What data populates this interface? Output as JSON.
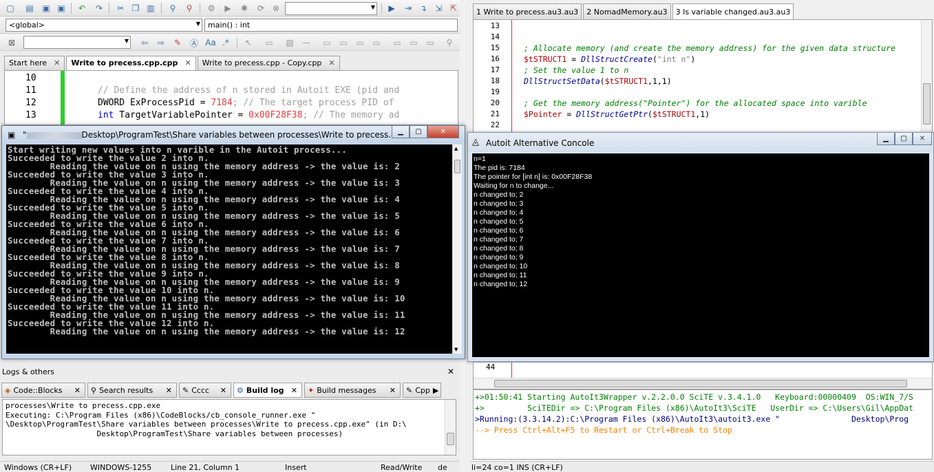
{
  "codeblocks": {
    "scope_combo": "<global>",
    "function_combo": "main() : int",
    "tabs": [
      {
        "label": "Start here",
        "active": false
      },
      {
        "label": "Write to precess.cpp.cpp",
        "active": true
      },
      {
        "label": "Write to precess.cpp - Copy.cpp",
        "active": false
      }
    ],
    "editor_lines": [
      {
        "num": "10",
        "text": ""
      },
      {
        "num": "11",
        "text": "// Define the address of n stored in Autoit EXE (pid and"
      },
      {
        "num": "12",
        "text_kw": "DWORD ExProcessPid = ",
        "text_num": "7184",
        "text_cmt": "; // The target process PID of"
      },
      {
        "num": "13",
        "text_kw": "int",
        "text_mid": " TargetVariablePointer = ",
        "text_num": "0x00F28F38",
        "text_cmt": "; // The memory ad"
      }
    ],
    "logs": {
      "header": "Logs & others",
      "tabs": [
        {
          "label": "Code::Blocks",
          "active": false
        },
        {
          "label": "Search results",
          "active": false
        },
        {
          "label": "Cccc",
          "active": false
        },
        {
          "label": "Build log",
          "active": true
        },
        {
          "label": "Build messages",
          "active": false
        },
        {
          "label": "Cpp",
          "active": false
        }
      ],
      "text": "processes\\Write to precess.cpp.exe\nExecuting: C:\\Program Files (x86)\\CodeBlocks/cb_console_runner.exe \"\n\\Desktop\\ProgramTest\\Share variables between processes\\Write to precess.cpp.exe\" (in D:\\\n                    Desktop\\ProgramTest\\Share variables between processes)"
    },
    "status": {
      "eol": "Windows (CR+LF)",
      "encoding": "WINDOWS-1255",
      "position": "Line 21, Column 1",
      "mode": "Insert",
      "access": "Read/Write",
      "extra": "de"
    }
  },
  "console": {
    "title_prefix": "\"",
    "title": "Desktop\\ProgramTest\\Share variables between processes\\Write to precess.c...",
    "output": "Start writing new values into n varible in the Autoit process...\nSucceeded to write the value 2 into n.\n        Reading the value on n using the memory address -> the value is: 2\nSucceeded to write the value 3 into n.\n        Reading the value on n using the memory address -> the value is: 3\nSucceeded to write the value 4 into n.\n        Reading the value on n using the memory address -> the value is: 4\nSucceeded to write the value 5 into n.\n        Reading the value on n using the memory address -> the value is: 5\nSucceeded to write the value 6 into n.\n        Reading the value on n using the memory address -> the value is: 6\nSucceeded to write the value 7 into n.\n        Reading the value on n using the memory address -> the value is: 7\nSucceeded to write the value 8 into n.\n        Reading the value on n using the memory address -> the value is: 8\nSucceeded to write the value 9 into n.\n        Reading the value on n using the memory address -> the value is: 9\nSucceeded to write the value 10 into n.\n        Reading the value on n using the memory address -> the value is: 10\nSucceeded to write the value 11 into n.\n        Reading the value on n using the memory address -> the value is: 11\nSucceeded to write the value 12 into n.\n        Reading the value on n using the memory address -> the value is: 12"
  },
  "scite": {
    "tabs": [
      {
        "label": "1 Write to precess.au3.au3",
        "active": false
      },
      {
        "label": "2 NomadMemory.au3",
        "active": false
      },
      {
        "label": "3 Is variable changed.au3.au3",
        "active": true
      }
    ],
    "lines": [
      {
        "num": "13",
        "parts": []
      },
      {
        "num": "14",
        "parts": []
      },
      {
        "num": "15",
        "parts": [
          {
            "c": "scmt",
            "t": "; Allocate memory (and create the memory address) for the given data structure"
          }
        ]
      },
      {
        "num": "16",
        "parts": [
          {
            "c": "svar",
            "t": "$tSTRUCT1"
          },
          {
            "c": "",
            "t": " = "
          },
          {
            "c": "sfn",
            "t": "DllStructCreate"
          },
          {
            "c": "",
            "t": "("
          },
          {
            "c": "sstr",
            "t": "\"int n\""
          },
          {
            "c": "",
            "t": ")"
          }
        ]
      },
      {
        "num": "17",
        "parts": [
          {
            "c": "scmt",
            "t": "; Set the value 1 to n"
          }
        ]
      },
      {
        "num": "18",
        "parts": [
          {
            "c": "sfn",
            "t": "DllStructSetData"
          },
          {
            "c": "",
            "t": "("
          },
          {
            "c": "svar",
            "t": "$tSTRUCT1"
          },
          {
            "c": "",
            "t": ",1,1)"
          }
        ]
      },
      {
        "num": "19",
        "parts": []
      },
      {
        "num": "20",
        "parts": [
          {
            "c": "scmt",
            "t": "; Get the memory address(\"Pointer\") for the allocated space into varible"
          }
        ]
      },
      {
        "num": "21",
        "parts": [
          {
            "c": "svar",
            "t": "$Pointer"
          },
          {
            "c": "",
            "t": " = "
          },
          {
            "c": "sfn",
            "t": "DllStructGetPtr"
          },
          {
            "c": "",
            "t": "("
          },
          {
            "c": "svar",
            "t": "$tSTRUCT1"
          },
          {
            "c": "",
            "t": ",1)"
          }
        ]
      },
      {
        "num": "22",
        "parts": []
      }
    ],
    "line44": "44",
    "output": [
      {
        "c": "o-green",
        "t": "+>01:50:41 Starting AutoIt3Wrapper v.2.2.0.0 SciTE v.3.4.1.0   Keyboard:00000409  OS:WIN_7/S"
      },
      {
        "c": "o-green",
        "t": "+>         SciTEDir => C:\\Program Files (x86)\\AutoIt3\\SciTE   UserDir => C:\\Users\\Gil\\AppDat"
      },
      {
        "c": "o-blue",
        "t": ">Running:(3.3.14.2):C:\\Program Files (x86)\\AutoIt3\\autoit3.exe \"               Desktop\\Prog"
      },
      {
        "c": "o-orange",
        "t": "--> Press Ctrl+Alt+F5 to Restart or Ctrl+Break to Stop"
      }
    ],
    "status": "li=24 co=1 INS (CR+LF)"
  },
  "alt_console": {
    "title": "Autoit Alternative Concole",
    "output": "n=1\nThe pid is: 7184\nThe pointer for [int n] is: 0x00F28F38\nWaiting for n to change...\nn changed to; 2\nn changed to; 3\nn changed to; 4\nn changed to; 5\nn changed to; 6\nn changed to; 7\nn changed to; 8\nn changed to; 9\nn changed to; 10\nn changed to; 11\nn changed to; 12"
  },
  "colors": {
    "change_bar": "#2bd12b",
    "margin_line": "#e03030",
    "console_bg": "#000000"
  }
}
